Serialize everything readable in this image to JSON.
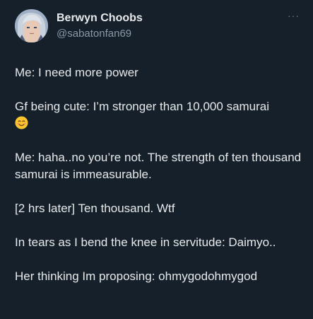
{
  "user": {
    "display_name": "Berwyn Choobs",
    "handle": "@sabatonfan69",
    "avatar_icon": "anime-character-avatar"
  },
  "menu": {
    "more_label": "···"
  },
  "tweet": {
    "line1": "Me: I need more power",
    "line2": "Gf being cute: I’m stronger than 10,000 samurai",
    "line2_emoji": "smiling-face-emoji",
    "line3": "Me: haha..no you’re not. The strength of ten thousand samurai is immeasurable.",
    "line4": "[2 hrs later] Ten thousand. Wtf",
    "line5": "In tears as I bend the knee in servitude: Daimyo..",
    "line6": "Her thinking Im proposing: ohmygodohmygod"
  },
  "colors": {
    "background": "#15202b",
    "text_primary": "#e7e9ea",
    "text_secondary": "#8b98a5"
  }
}
